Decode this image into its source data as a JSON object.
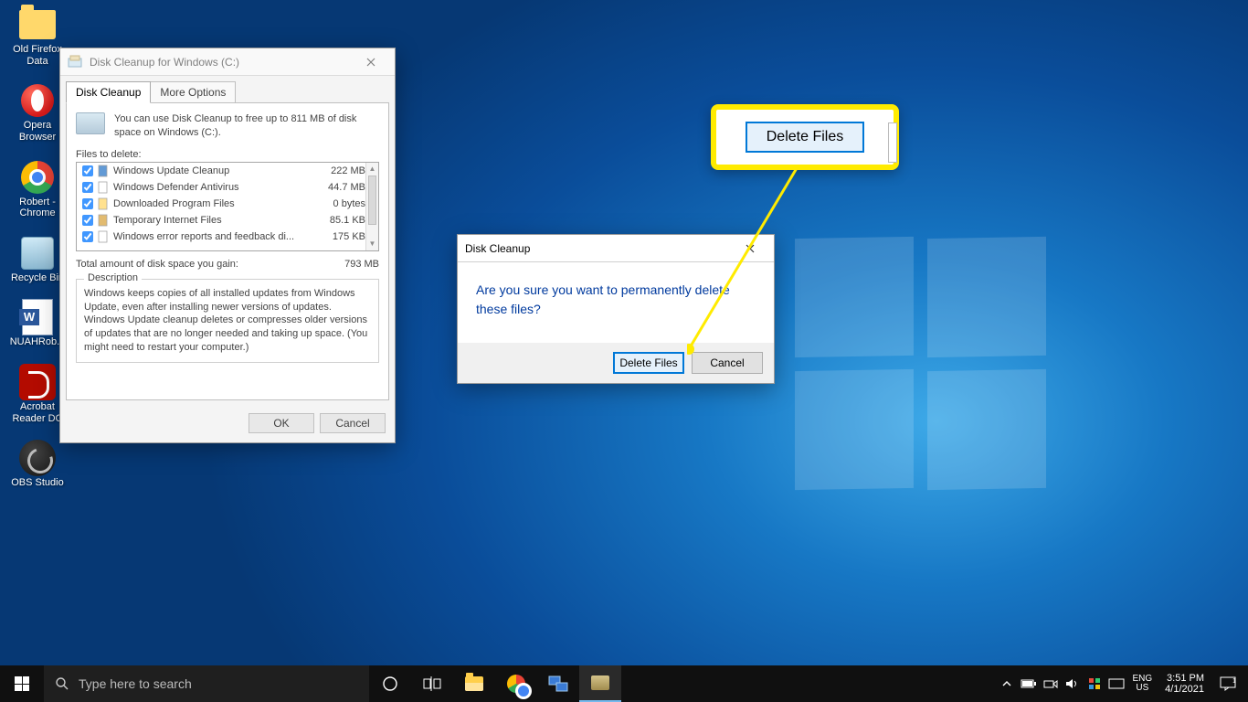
{
  "desktop_icons": [
    {
      "name": "old-firefox-data",
      "label": "Old Firefox Data",
      "glyph": "folder"
    },
    {
      "name": "opera-browser",
      "label": "Opera Browser",
      "glyph": "opera"
    },
    {
      "name": "robert-chrome",
      "label": "Robert - Chrome",
      "glyph": "chrome"
    },
    {
      "name": "recycle-bin",
      "label": "Recycle Bin",
      "glyph": "bin"
    },
    {
      "name": "nuah-robert",
      "label": "NUAHRob...",
      "glyph": "word"
    },
    {
      "name": "acrobat-reader",
      "label": "Acrobat Reader DC",
      "glyph": "acro"
    },
    {
      "name": "obs-studio",
      "label": "OBS Studio",
      "glyph": "obs"
    }
  ],
  "disk_cleanup": {
    "title": "Disk Cleanup for Windows (C:)",
    "tabs": {
      "cleanup": "Disk Cleanup",
      "more": "More Options"
    },
    "intro": "You can use Disk Cleanup to free up to 811 MB of disk space on Windows (C:).",
    "files_label": "Files to delete:",
    "items": [
      {
        "name": "Windows Update Cleanup",
        "size": "222 MB",
        "checked": true,
        "color": "#2e78c7"
      },
      {
        "name": "Windows Defender Antivirus",
        "size": "44.7 MB",
        "checked": true,
        "color": "#ffffff"
      },
      {
        "name": "Downloaded Program Files",
        "size": "0 bytes",
        "checked": true,
        "color": "#ffd76a"
      },
      {
        "name": "Temporary Internet Files",
        "size": "85.1 KB",
        "checked": true,
        "color": "#d9a441"
      },
      {
        "name": "Windows error reports and feedback di...",
        "size": "175 KB",
        "checked": true,
        "color": "#ffffff"
      }
    ],
    "total_label": "Total amount of disk space you gain:",
    "total_value": "793 MB",
    "desc_legend": "Description",
    "desc_text": "Windows keeps copies of all installed updates from Windows Update, even after installing newer versions of updates. Windows Update cleanup deletes or compresses older versions of updates that are no longer needed and taking up space. (You might need to restart your computer.)",
    "ok": "OK",
    "cancel": "Cancel"
  },
  "confirm": {
    "title": "Disk Cleanup",
    "message": "Are you sure you want to permanently delete these files?",
    "delete": "Delete Files",
    "cancel": "Cancel"
  },
  "callout": {
    "label": "Delete Files"
  },
  "taskbar": {
    "search_placeholder": "Type here to search",
    "lang_top": "ENG",
    "lang_bot": "US",
    "time": "3:51 PM",
    "date": "4/1/2021"
  }
}
